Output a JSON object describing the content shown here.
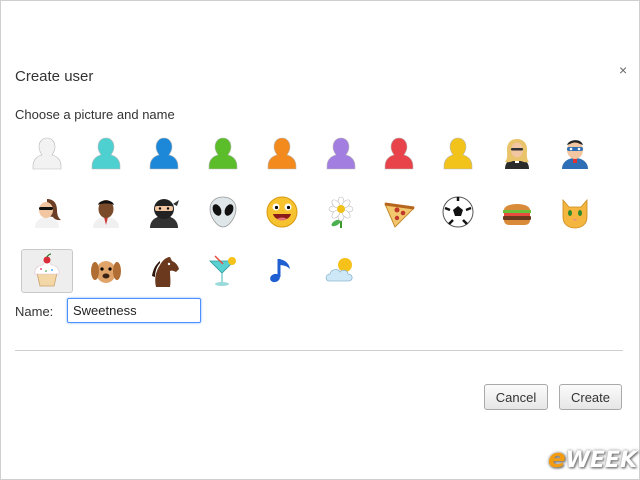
{
  "dialog": {
    "title": "Create user",
    "close_glyph": "×",
    "subtitle": "Choose a picture and name"
  },
  "avatars": [
    {
      "name": "white-person-icon",
      "kind": "person",
      "color": "#f2f2f2",
      "selected": false
    },
    {
      "name": "teal-person-icon",
      "kind": "person",
      "color": "#4fd0d0",
      "selected": false
    },
    {
      "name": "blue-person-icon",
      "kind": "person",
      "color": "#1e88d8",
      "selected": false
    },
    {
      "name": "green-person-icon",
      "kind": "person",
      "color": "#5cbd2a",
      "selected": false
    },
    {
      "name": "orange-person-icon",
      "kind": "person",
      "color": "#f28a1e",
      "selected": false
    },
    {
      "name": "purple-person-icon",
      "kind": "person",
      "color": "#a27ee0",
      "selected": false
    },
    {
      "name": "red-person-icon",
      "kind": "person",
      "color": "#e8434b",
      "selected": false
    },
    {
      "name": "yellow-person-icon",
      "kind": "person",
      "color": "#f2c31a",
      "selected": false
    },
    {
      "name": "blonde-businesswoman-icon",
      "kind": "woman",
      "color": "#e9c46a",
      "selected": false
    },
    {
      "name": "superhero-icon",
      "kind": "hero",
      "color": "#2f6fb5",
      "selected": false
    },
    {
      "name": "woman-with-sunglasses-icon",
      "kind": "shades",
      "color": "#6b3e26",
      "selected": false
    },
    {
      "name": "businessman-icon",
      "kind": "man",
      "color": "#7a4b2a",
      "selected": false
    },
    {
      "name": "ninja-icon",
      "kind": "ninja",
      "color": "#222222",
      "selected": false
    },
    {
      "name": "alien-icon",
      "kind": "alien",
      "color": "#dfe6e9",
      "selected": false
    },
    {
      "name": "smiley-face-icon",
      "kind": "smiley",
      "color": "#f6c22e",
      "selected": false
    },
    {
      "name": "daisy-flower-icon",
      "kind": "flower",
      "color": "#ffffff",
      "selected": false
    },
    {
      "name": "pizza-slice-icon",
      "kind": "pizza",
      "color": "#f2c76e",
      "selected": false
    },
    {
      "name": "soccer-ball-icon",
      "kind": "ball",
      "color": "#ffffff",
      "selected": false
    },
    {
      "name": "hamburger-icon",
      "kind": "burger",
      "color": "#d98b3a",
      "selected": false
    },
    {
      "name": "orange-cat-icon",
      "kind": "cat",
      "color": "#f4b63f",
      "selected": false
    },
    {
      "name": "cupcake-icon",
      "kind": "cupcake",
      "color": "#f5d9a8",
      "selected": true
    },
    {
      "name": "puppy-icon",
      "kind": "dog",
      "color": "#e0a36a",
      "selected": false
    },
    {
      "name": "horse-icon",
      "kind": "horse",
      "color": "#6b3a1e",
      "selected": false
    },
    {
      "name": "cocktail-glass-icon",
      "kind": "cocktail",
      "color": "#5ad1d1",
      "selected": false
    },
    {
      "name": "music-note-icon",
      "kind": "note",
      "color": "#1f5fd1",
      "selected": false
    },
    {
      "name": "sun-cloud-icon",
      "kind": "weather",
      "color": "#cfe8f7",
      "selected": false
    }
  ],
  "form": {
    "name_label": "Name:",
    "name_value": "Sweetness"
  },
  "buttons": {
    "cancel": "Cancel",
    "create": "Create"
  },
  "watermark": "eWEEK"
}
